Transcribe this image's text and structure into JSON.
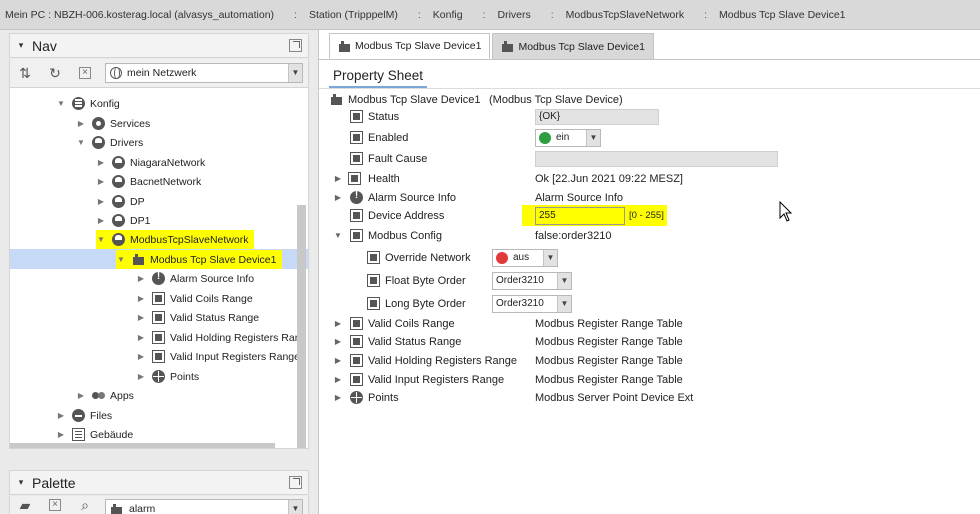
{
  "breadcrumb": [
    "Mein PC : NBZH-006.kosterag.local (alvasys_automation)",
    "Station (TripppelM)",
    "Konfig",
    "Drivers",
    "ModbusTcpSlaveNetwork",
    "Modbus Tcp Slave Device1"
  ],
  "nav": {
    "title": "Nav",
    "network_select": "mein Netzwerk",
    "tree": [
      {
        "label": "Konfig",
        "icon": "folder-icon",
        "expanded": true
      },
      {
        "label": "Services",
        "icon": "gear-icon",
        "expanded": false
      },
      {
        "label": "Drivers",
        "icon": "driver-icon",
        "expanded": true
      },
      {
        "label": "NiagaraNetwork",
        "icon": "network-icon",
        "expanded": false
      },
      {
        "label": "BacnetNetwork",
        "icon": "network-icon",
        "expanded": false
      },
      {
        "label": "DP",
        "icon": "network-icon",
        "expanded": false
      },
      {
        "label": "DP1",
        "icon": "network-icon",
        "expanded": false
      },
      {
        "label": "ModbusTcpSlaveNetwork",
        "icon": "network-icon",
        "expanded": true,
        "highlighted": true
      },
      {
        "label": "Modbus Tcp Slave Device1",
        "icon": "device-icon",
        "expanded": true,
        "highlighted": true,
        "selected": true
      },
      {
        "label": "Alarm Source Info",
        "icon": "alarm-icon",
        "expanded": false
      },
      {
        "label": "Valid Coils Range",
        "icon": "range-icon",
        "expanded": false
      },
      {
        "label": "Valid Status Range",
        "icon": "range-icon",
        "expanded": false
      },
      {
        "label": "Valid Holding Registers Rang",
        "icon": "range-icon",
        "expanded": false
      },
      {
        "label": "Valid Input Registers Range",
        "icon": "range-icon",
        "expanded": false
      },
      {
        "label": "Points",
        "icon": "points-icon",
        "expanded": false
      },
      {
        "label": "Apps",
        "icon": "apps-icon",
        "expanded": false
      },
      {
        "label": "Files",
        "icon": "files-icon",
        "expanded": false
      },
      {
        "label": "Gebäude",
        "icon": "building-icon",
        "expanded": false
      }
    ]
  },
  "palette": {
    "title": "Palette",
    "select": "alarm"
  },
  "tabs": [
    "Modbus Tcp Slave Device1",
    "Modbus Tcp Slave Device1"
  ],
  "view_title": "Property Sheet",
  "sheet": {
    "header_name": "Modbus Tcp Slave Device1",
    "header_type": "(Modbus Tcp Slave Device)",
    "status_label": "Status",
    "status_value": "{OK}",
    "enabled_label": "Enabled",
    "enabled_value": "ein",
    "fault_label": "Fault Cause",
    "health_label": "Health",
    "health_value": "Ok [22.Jun 2021 09:22 MESZ]",
    "alarm_label": "Alarm Source Info",
    "alarm_value": "Alarm Source Info",
    "address_label": "Device Address",
    "address_value": "255",
    "address_range": "[0 - 255]",
    "modbus_config_label": "Modbus Config",
    "modbus_config_value": "false:order3210",
    "override_label": "Override Network",
    "override_value": "aus",
    "float_label": "Float Byte Order",
    "float_value": "Order3210",
    "long_label": "Long Byte Order",
    "long_value": "Order3210",
    "coils_label": "Valid Coils Range",
    "coils_value": "Modbus Register Range Table",
    "status_range_label": "Valid Status Range",
    "status_range_value": "Modbus Register Range Table",
    "holding_label": "Valid Holding Registers Range",
    "holding_value": "Modbus Register Range Table",
    "input_label": "Valid Input Registers Range",
    "input_value": "Modbus Register Range Table",
    "points_label": "Points",
    "points_value": "Modbus Server Point Device Ext"
  },
  "colors": {
    "highlight": "#ffff00",
    "selection": "#c6d9f7",
    "enabled_dot": "#2e9e3e",
    "disabled_dot": "#e23a3a"
  }
}
